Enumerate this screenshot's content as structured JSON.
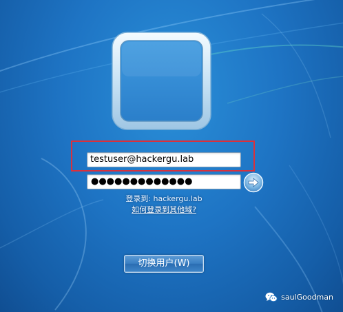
{
  "login": {
    "username_value": "testuser@hackergu.lab",
    "password_mask": "●●●●●●●●●●●●●",
    "domain_text": "登录到: hackergu.lab",
    "other_domain_link": "如何登录到其他域?",
    "switch_user_label": "切换用户(W)"
  },
  "watermark": {
    "text": "saulGoodman",
    "icon": "wechat-icon"
  },
  "colors": {
    "highlight_box": "#d9313c",
    "background": "#1e74c4"
  }
}
